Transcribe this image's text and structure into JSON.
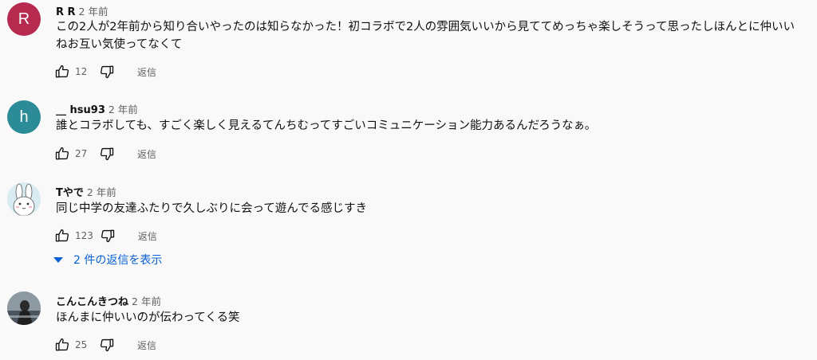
{
  "comments": [
    {
      "author": "R R",
      "time": "2 年前",
      "avatar_letter": "R",
      "avatar_color": "#b52a4e",
      "text": "この2人が2年前から知り合いやったのは知らなかった！初コラボで2人の雰囲気いいから見ててめっちゃ楽しそうって思ったしほんとに仲いいねお互い気使ってなくて",
      "likes": "12",
      "reply_label": "返信"
    },
    {
      "author": "__ hsu93",
      "time": "2 年前",
      "avatar_letter": "h",
      "avatar_color": "#2b8b96",
      "text": "誰とコラボしても、すごく楽しく見えるてんちむってすごいコミュニケーション能力あるんだろうなぁ。",
      "likes": "27",
      "reply_label": "返信"
    },
    {
      "author": "Tやで",
      "time": "2 年前",
      "text": "同じ中学の友達ふたりで久しぶりに会って遊んでる感じすき",
      "likes": "123",
      "reply_label": "返信",
      "replies_label": "2 件の返信を表示"
    },
    {
      "author": "こんこんきつね",
      "time": "2 年前",
      "text": "ほんまに仲いいのが伝わってくる笑",
      "likes": "25",
      "reply_label": "返信"
    }
  ],
  "icons": {
    "like": "thumbs-up-icon",
    "dislike": "thumbs-down-icon",
    "expand": "triangle-down-icon"
  },
  "colors": {
    "link": "#065fd4",
    "secondary_text": "#606060"
  }
}
